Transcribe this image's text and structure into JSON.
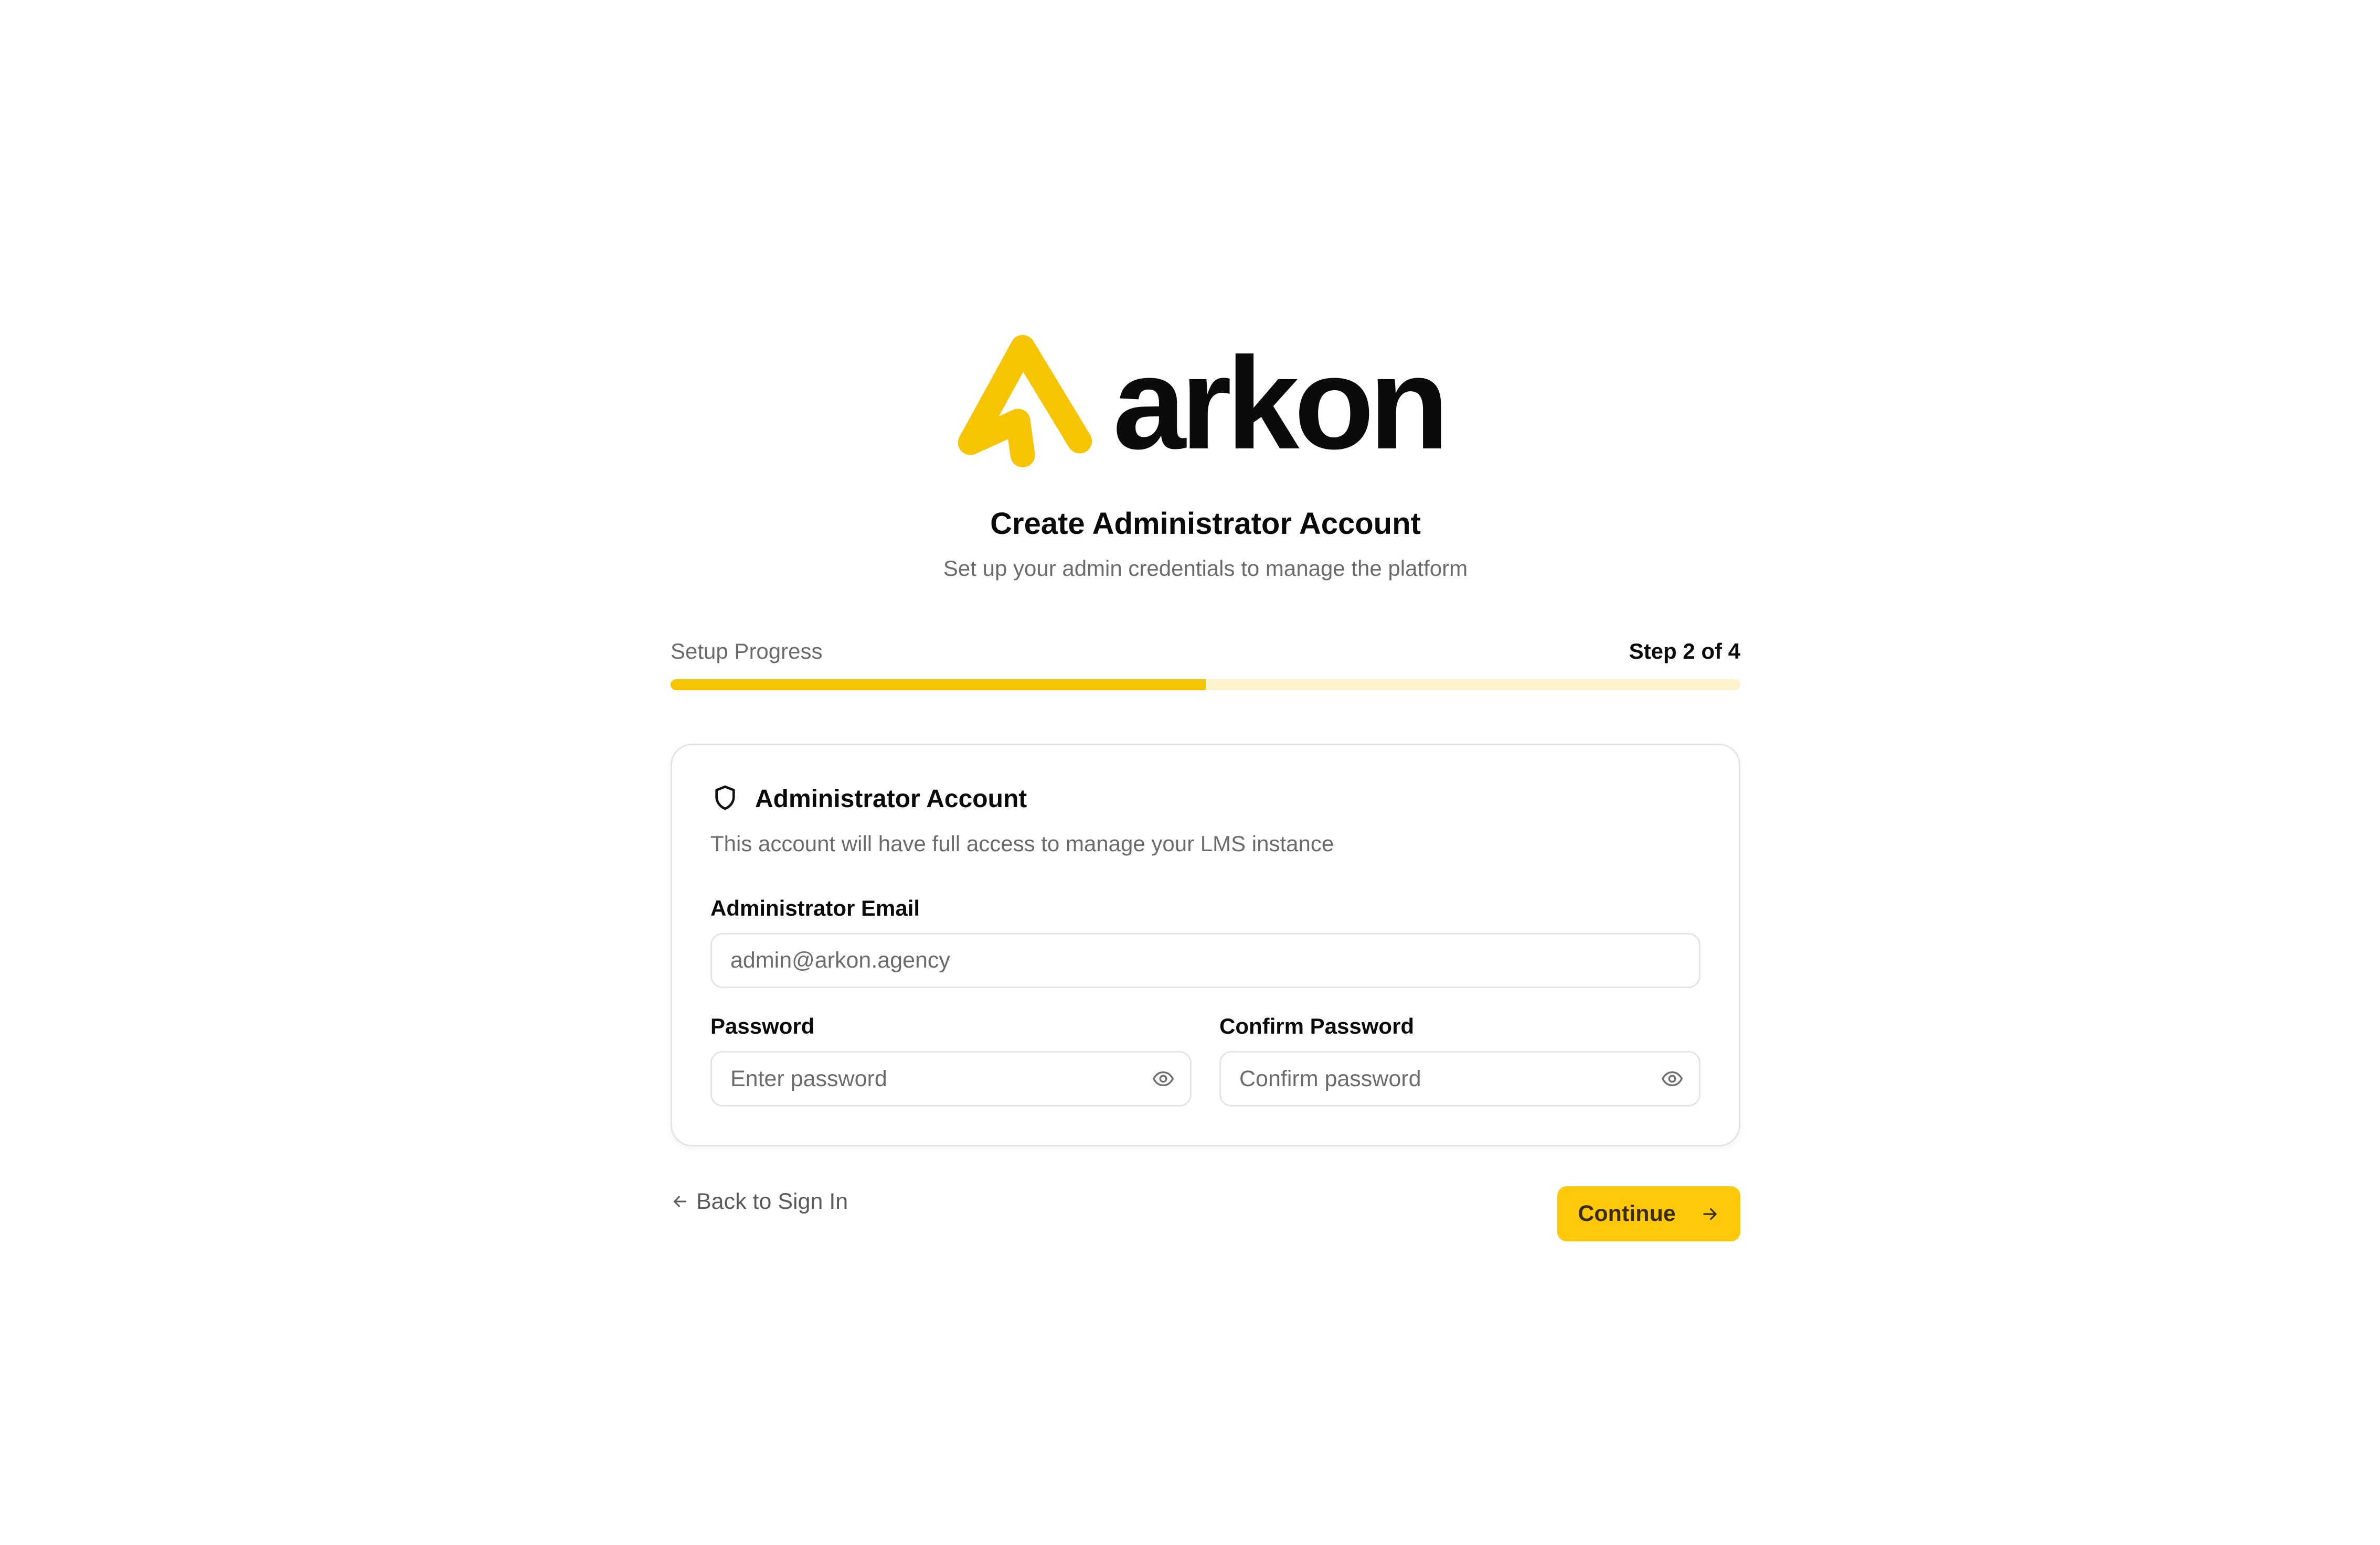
{
  "brand": {
    "name": "arkon",
    "logo_icon": "arkon-arrow-logo-icon"
  },
  "header": {
    "title": "Create Administrator Account",
    "subtitle": "Set up your admin credentials to manage the platform"
  },
  "progress": {
    "label": "Setup Progress",
    "step_text": "Step 2 of 4",
    "fill_fraction": 0.5
  },
  "card": {
    "icon": "shield-icon",
    "title": "Administrator Account",
    "description": "This account will have full access to manage your LMS instance",
    "fields": {
      "email": {
        "label": "Administrator Email",
        "placeholder": "admin@arkon.agency"
      },
      "password": {
        "label": "Password",
        "placeholder": "Enter password",
        "toggle_icon": "eye-icon"
      },
      "confirm_password": {
        "label": "Confirm Password",
        "placeholder": "Confirm password",
        "toggle_icon": "eye-icon"
      }
    }
  },
  "actions": {
    "back_label": "Back to Sign In",
    "back_icon": "arrow-left-icon",
    "continue_label": "Continue",
    "continue_icon": "arrow-right-icon"
  },
  "colors": {
    "accent": "#F6C400",
    "progress_track": "#FDF2CC",
    "button_background": "#FEC80B",
    "button_text": "#3A2C00"
  }
}
